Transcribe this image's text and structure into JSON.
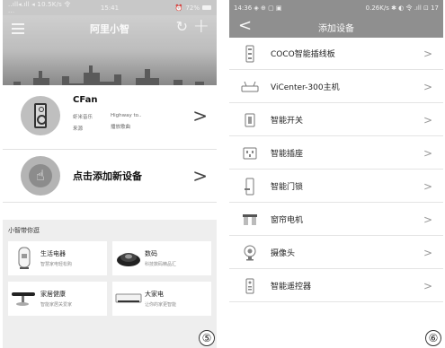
{
  "left_phone": {
    "status_bar": {
      "signal_text": "..ıll◂.ıll ◂ 10.5K/s 令 ···",
      "time": "15:41",
      "battery_text": "72%"
    },
    "header": {
      "title": "阿里小智"
    },
    "device_card": {
      "name": "CFan",
      "meta_col1": [
        "虾米音乐",
        "来源"
      ],
      "meta_col2": [
        "Highway to..",
        "播放歌曲"
      ]
    },
    "add_card": {
      "label": "点击添加新设备"
    },
    "recommend": {
      "title": "小智带你逛",
      "tiles": [
        {
          "name": "生活电器",
          "sub": "智慧家电轻松购",
          "icon": "air-purifier-icon"
        },
        {
          "name": "数码",
          "sub": "科技数码精品汇",
          "icon": "speaker-dome-icon"
        },
        {
          "name": "家居健康",
          "sub": "智能家居关爱家",
          "icon": "scale-icon"
        },
        {
          "name": "大家电",
          "sub": "让你的家更智能",
          "icon": "air-conditioner-icon"
        }
      ]
    },
    "figure_marker": "⑤"
  },
  "right_phone": {
    "status_bar": {
      "left_text": "14:36 ◈ ⊕ ▢ ▣",
      "right_text": "0.26K/s ✱ ◐ 令 .ıll ⊡ 17"
    },
    "header": {
      "back_symbol": "<",
      "title": "添加设备"
    },
    "items": [
      {
        "label": "COCO智能插线板",
        "icon": "power-strip-icon"
      },
      {
        "label": "ViCenter-300主机",
        "icon": "router-icon"
      },
      {
        "label": "智能开关",
        "icon": "switch-icon"
      },
      {
        "label": "智能插座",
        "icon": "socket-icon"
      },
      {
        "label": "智能门锁",
        "icon": "door-lock-icon"
      },
      {
        "label": "窗帘电机",
        "icon": "curtain-motor-icon"
      },
      {
        "label": "摄像头",
        "icon": "camera-icon"
      },
      {
        "label": "智能遥控器",
        "icon": "remote-control-icon"
      }
    ],
    "chevron": ">",
    "figure_marker": "⑥"
  }
}
